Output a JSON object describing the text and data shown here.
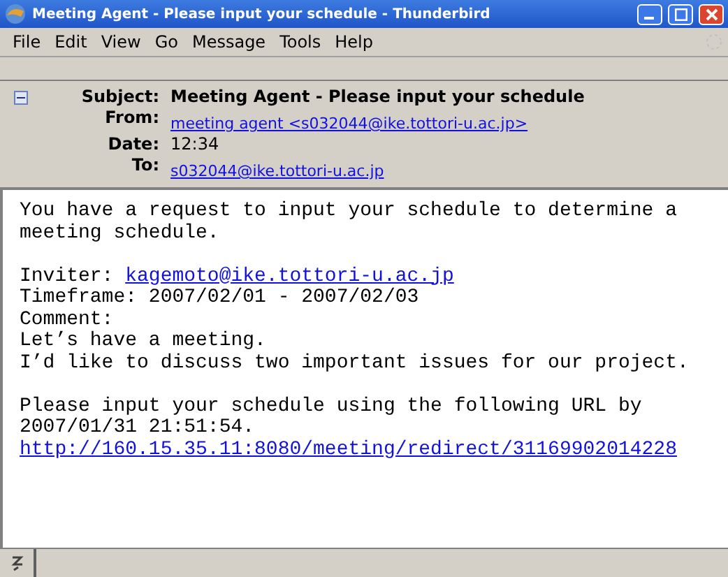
{
  "window": {
    "title": "Meeting Agent - Please input your schedule - Thunderbird"
  },
  "menu": [
    "File",
    "Edit",
    "View",
    "Go",
    "Message",
    "Tools",
    "Help"
  ],
  "header": {
    "expanded": true,
    "fields": [
      {
        "kind": "text",
        "label": "Subject:",
        "value": "Meeting Agent - Please input your schedule"
      },
      {
        "kind": "link",
        "label": "From:",
        "value": "meeting agent <s032044@ike.tottori-u.ac.jp>"
      },
      {
        "kind": "plain",
        "label": "Date:",
        "value": "12:34"
      },
      {
        "kind": "link",
        "label": "To:",
        "value": "s032044@ike.tottori-u.ac.jp"
      }
    ]
  },
  "body": [
    [
      {
        "kind": "text",
        "text": "You have a request to input your schedule to determine a meeting schedule."
      }
    ],
    [
      {
        "kind": "field",
        "label": "Inviter:",
        "link": "kagemoto@ike.tottori-u.ac.jp"
      },
      {
        "kind": "text",
        "text": "Timeframe: 2007/02/01 - 2007/02/03"
      },
      {
        "kind": "text",
        "text": "Comment:"
      },
      {
        "kind": "text",
        "text": "Let’s have a meeting."
      },
      {
        "kind": "text",
        "text": "I’d like to discuss two important issues for our project."
      }
    ],
    [
      {
        "kind": "text",
        "text": "Please input your schedule using the following URL by 2007/01/31 21:51:54."
      },
      {
        "kind": "link",
        "link": "http://160.15.35.11:8080/meeting/redirect/31169902014228"
      }
    ]
  ]
}
